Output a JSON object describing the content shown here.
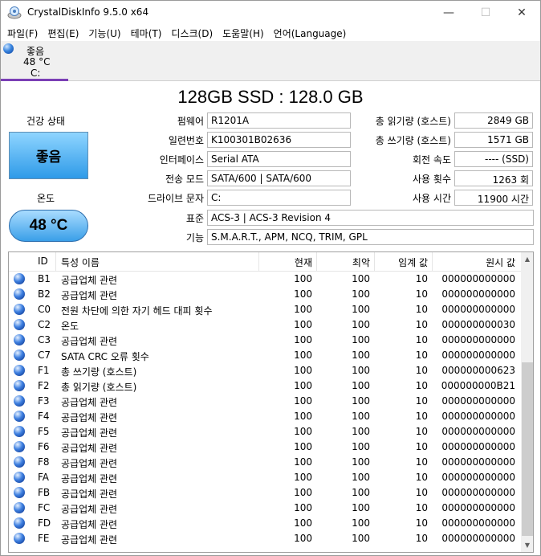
{
  "window": {
    "title": "CrystalDiskInfo 9.5.0 x64",
    "min_glyph": "—",
    "max_glyph": "☐",
    "close_glyph": "✕"
  },
  "menu": [
    "파일(F)",
    "편집(E)",
    "기능(U)",
    "테마(T)",
    "디스크(D)",
    "도움말(H)",
    "언어(Language)"
  ],
  "disk_tab": {
    "status": "좋음",
    "temp": "48 °C",
    "letter": "C:"
  },
  "disk": {
    "title": "128GB SSD : 128.0 GB",
    "health_label": "건강 상태",
    "health_status": "좋음",
    "temp_label": "온도",
    "temperature": "48 °C",
    "health_color": "#2e9ae8"
  },
  "fields": {
    "firmware_label": "펌웨어",
    "firmware": "R1201A",
    "serial_label": "일련번호",
    "serial": "K100301B02636",
    "interface_label": "인터페이스",
    "interface": "Serial ATA",
    "transfer_label": "전송 모드",
    "transfer": "SATA/600 | SATA/600",
    "drive_label": "드라이브 문자",
    "drive": "C:",
    "standard_label": "표준",
    "standard": "ACS-3 | ACS-3 Revision 4",
    "features_label": "기능",
    "features": "S.M.A.R.T., APM, NCQ, TRIM, GPL",
    "host_reads_label": "총 읽기량 (호스트)",
    "host_reads": "2849 GB",
    "host_writes_label": "총 쓰기량 (호스트)",
    "host_writes": "1571 GB",
    "rotation_label": "회전 속도",
    "rotation": "---- (SSD)",
    "power_count_label": "사용 횟수",
    "power_count": "1263 회",
    "power_hours_label": "사용 시간",
    "power_hours": "11900 시간"
  },
  "table": {
    "headers": [
      "ID",
      "특성 이름",
      "현재",
      "최악",
      "임계 값",
      "원시 값"
    ],
    "rows": [
      [
        "B1",
        "공급업체 관련",
        "100",
        "100",
        "10",
        "000000000000"
      ],
      [
        "B2",
        "공급업체 관련",
        "100",
        "100",
        "10",
        "000000000000"
      ],
      [
        "C0",
        "전원 차단에 의한 자기 헤드 대피 횟수",
        "100",
        "100",
        "10",
        "000000000000"
      ],
      [
        "C2",
        "온도",
        "100",
        "100",
        "10",
        "000000000030"
      ],
      [
        "C3",
        "공급업체 관련",
        "100",
        "100",
        "10",
        "000000000000"
      ],
      [
        "C7",
        "SATA CRC 오류 횟수",
        "100",
        "100",
        "10",
        "000000000000"
      ],
      [
        "F1",
        "총 쓰기량 (호스트)",
        "100",
        "100",
        "10",
        "000000000623"
      ],
      [
        "F2",
        "총 읽기량 (호스트)",
        "100",
        "100",
        "10",
        "000000000B21"
      ],
      [
        "F3",
        "공급업체 관련",
        "100",
        "100",
        "10",
        "000000000000"
      ],
      [
        "F4",
        "공급업체 관련",
        "100",
        "100",
        "10",
        "000000000000"
      ],
      [
        "F5",
        "공급업체 관련",
        "100",
        "100",
        "10",
        "000000000000"
      ],
      [
        "F6",
        "공급업체 관련",
        "100",
        "100",
        "10",
        "000000000000"
      ],
      [
        "F8",
        "공급업체 관련",
        "100",
        "100",
        "10",
        "000000000000"
      ],
      [
        "FA",
        "공급업체 관련",
        "100",
        "100",
        "10",
        "000000000000"
      ],
      [
        "FB",
        "공급업체 관련",
        "100",
        "100",
        "10",
        "000000000000"
      ],
      [
        "FC",
        "공급업체 관련",
        "100",
        "100",
        "10",
        "000000000000"
      ],
      [
        "FD",
        "공급업체 관련",
        "100",
        "100",
        "10",
        "000000000000"
      ],
      [
        "FE",
        "공급업체 관련",
        "100",
        "100",
        "10",
        "000000000000"
      ]
    ]
  }
}
